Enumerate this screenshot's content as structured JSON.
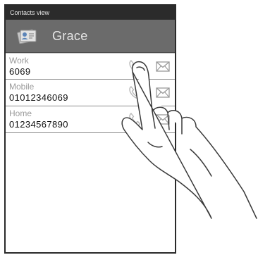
{
  "status_bar": {
    "title": "Contacts view"
  },
  "header": {
    "name": "Grace",
    "icon": "contact-card-icon"
  },
  "entries": [
    {
      "label": "Work",
      "value": "6069"
    },
    {
      "label": "Mobile",
      "value": "01012346069"
    },
    {
      "label": "Home",
      "value": "01234567890"
    }
  ],
  "icons": {
    "call": "phone-handset-icon",
    "message": "envelope-icon",
    "overlay": "pointing-hand"
  },
  "colors": {
    "status_bar": "#2b2b2b",
    "header": "#6b6b6b",
    "label": "#9a9a9a",
    "value": "#111111"
  }
}
